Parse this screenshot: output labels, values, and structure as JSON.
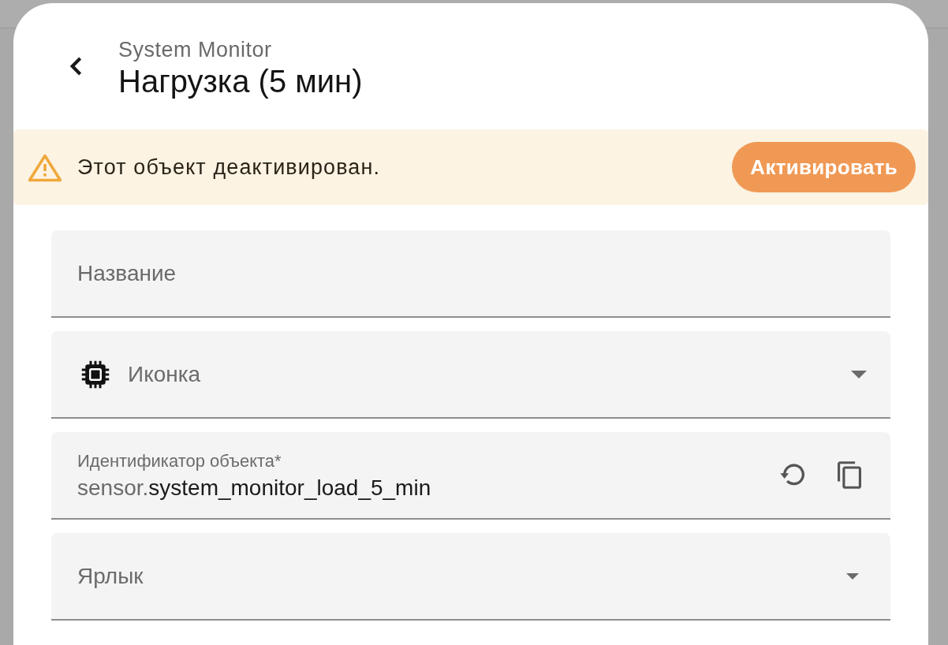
{
  "header": {
    "subtitle": "System Monitor",
    "title": "Нагрузка (5 мин)"
  },
  "alert": {
    "message": "Этот объект деактивирован.",
    "action": "Активировать"
  },
  "fields": [
    {
      "kind": "text",
      "placeholder": "Название"
    },
    {
      "kind": "icon_select",
      "placeholder": "Иконка"
    },
    {
      "kind": "entity_id",
      "label": "Идентификатор объекта*",
      "prefix": "sensor.",
      "value": "system_monitor_load_5_min"
    },
    {
      "kind": "select",
      "placeholder": "Ярлык"
    }
  ]
}
